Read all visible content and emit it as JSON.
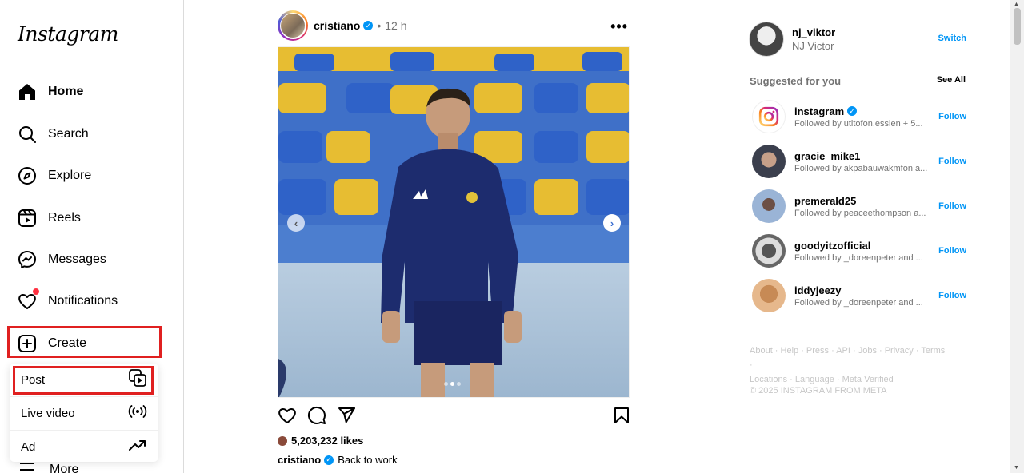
{
  "app": {
    "logo_text": "Instagram"
  },
  "sidebar": {
    "items": [
      {
        "label": "Home",
        "icon": "home-icon"
      },
      {
        "label": "Search",
        "icon": "search-icon"
      },
      {
        "label": "Explore",
        "icon": "compass-icon"
      },
      {
        "label": "Reels",
        "icon": "reels-icon"
      },
      {
        "label": "Messages",
        "icon": "messenger-icon"
      },
      {
        "label": "Notifications",
        "icon": "heart-icon"
      },
      {
        "label": "Create",
        "icon": "plus-square-icon"
      }
    ],
    "more_label": "More"
  },
  "create_menu": {
    "items": [
      {
        "label": "Post",
        "icon": "post-icon"
      },
      {
        "label": "Live video",
        "icon": "live-icon"
      },
      {
        "label": "Ad",
        "icon": "trending-icon"
      }
    ]
  },
  "post": {
    "username": "cristiano",
    "dot": "•",
    "time": "12 h",
    "more": "•••",
    "likes": "5,203,232 likes",
    "caption_user": "cristiano",
    "caption_text": "Back to work",
    "carousel": {
      "current": 2,
      "total": 3
    }
  },
  "right": {
    "current_user": {
      "handle": "nj_viktor",
      "name": "NJ Victor",
      "switch_label": "Switch"
    },
    "suggested_title": "Suggested for you",
    "see_all": "See All",
    "follow_label": "Follow",
    "suggestions": [
      {
        "name": "instagram",
        "verified": true,
        "sub": "Followed by utitofon.essien + 5..."
      },
      {
        "name": "gracie_mike1",
        "verified": false,
        "sub": "Followed by akpabauwakmfon a..."
      },
      {
        "name": "premerald25",
        "verified": false,
        "sub": "Followed by peaceethompson a..."
      },
      {
        "name": "goodyitzofficial",
        "verified": false,
        "sub": "Followed by _doreenpeter and ..."
      },
      {
        "name": "iddyjeezy",
        "verified": false,
        "sub": "Followed by _doreenpeter and ..."
      }
    ],
    "footer_line1": "About · Help · Press · API · Jobs · Privacy · Terms ·",
    "footer_line2": "Locations · Language · Meta Verified",
    "copyright": "© 2025 INSTAGRAM FROM META"
  }
}
